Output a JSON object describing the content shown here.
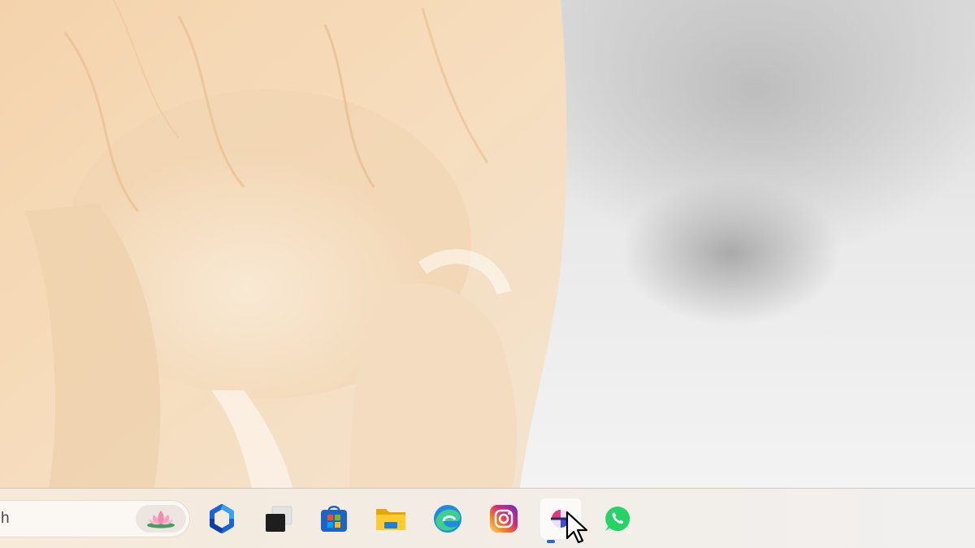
{
  "desktop": {
    "wallpaper": "dog-in-snow-wallpaper"
  },
  "taskbar": {
    "search": {
      "value": "h",
      "highlight_icon": "lotus-flower-icon"
    },
    "apps": [
      {
        "name": "copilot",
        "icon": "copilot-icon"
      },
      {
        "name": "task-view",
        "icon": "task-view-icon"
      },
      {
        "name": "microsoft-store",
        "icon": "microsoft-store-icon"
      },
      {
        "name": "file-explorer",
        "icon": "folder-icon"
      },
      {
        "name": "edge",
        "icon": "edge-icon"
      },
      {
        "name": "instagram",
        "icon": "instagram-icon"
      },
      {
        "name": "active-app",
        "icon": "app-icon",
        "active": true
      },
      {
        "name": "whatsapp",
        "icon": "whatsapp-icon"
      }
    ],
    "colors": {
      "running_indicator": "#2b63d8",
      "whatsapp": "#25d366",
      "edge": "#1f8ae0",
      "store": "#1e63c8"
    }
  }
}
